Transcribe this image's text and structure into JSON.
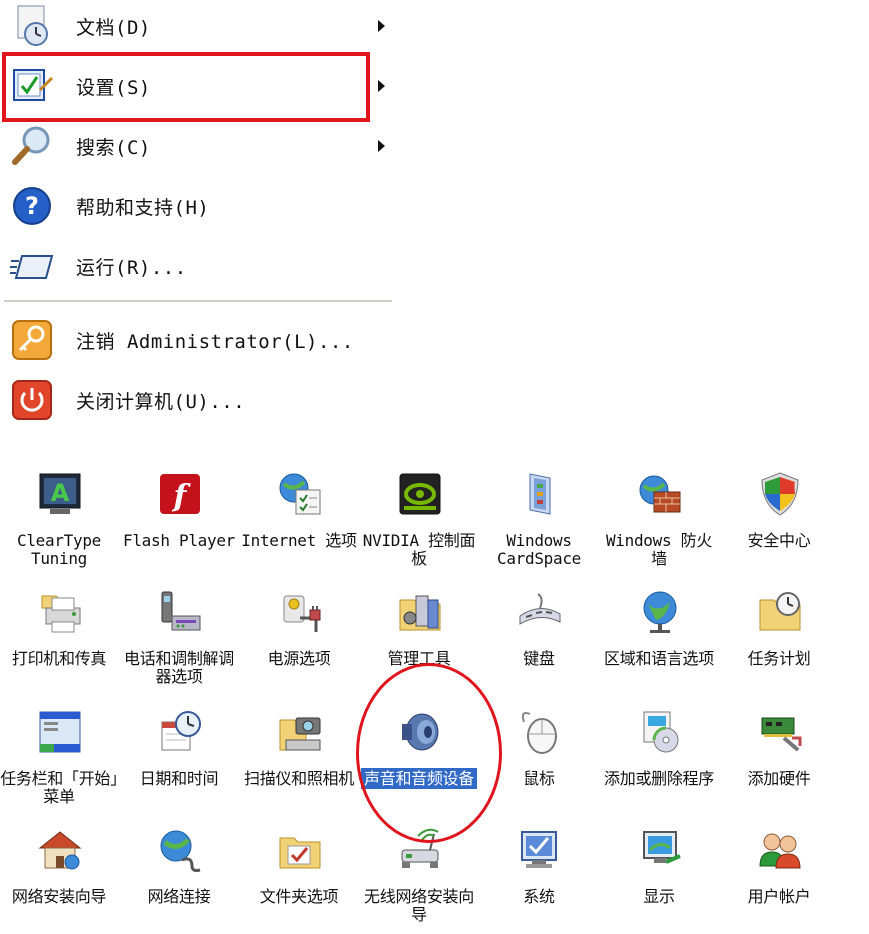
{
  "start_menu": {
    "items": [
      {
        "label": "文档(D)",
        "icon": "documents-icon",
        "has_submenu": true
      },
      {
        "label": "设置(S)",
        "icon": "settings-icon",
        "has_submenu": true
      },
      {
        "label": "搜索(C)",
        "icon": "search-icon",
        "has_submenu": true
      },
      {
        "label": "帮助和支持(H)",
        "icon": "help-icon",
        "has_submenu": false
      },
      {
        "label": "运行(R)...",
        "icon": "run-icon",
        "has_submenu": false
      },
      {
        "label": "注销 Administrator(L)...",
        "icon": "logoff-icon",
        "has_submenu": false
      },
      {
        "label": "关闭计算机(U)...",
        "icon": "shutdown-icon",
        "has_submenu": false
      }
    ],
    "highlight_color": "#e0141c"
  },
  "control_panel": {
    "selection_color": "#3169c6",
    "rows": [
      [
        {
          "label": "ClearType Tuning",
          "icon": "cleartype-icon"
        },
        {
          "label": "Flash Player",
          "icon": "flash-icon"
        },
        {
          "label": "Internet 选项",
          "icon": "internet-options-icon"
        },
        {
          "label": "NVIDIA 控制面板",
          "icon": "nvidia-icon"
        },
        {
          "label": "Windows CardSpace",
          "icon": "cardspace-icon"
        },
        {
          "label": "Windows 防火墙",
          "icon": "firewall-icon"
        },
        {
          "label": "安全中心",
          "icon": "security-center-icon"
        }
      ],
      [
        {
          "label": "打印机和传真",
          "icon": "printer-icon"
        },
        {
          "label": "电话和调制解调器选项",
          "icon": "phone-modem-icon"
        },
        {
          "label": "电源选项",
          "icon": "power-icon"
        },
        {
          "label": "管理工具",
          "icon": "admin-tools-icon"
        },
        {
          "label": "键盘",
          "icon": "keyboard-icon"
        },
        {
          "label": "区域和语言选项",
          "icon": "region-icon"
        },
        {
          "label": "任务计划",
          "icon": "scheduled-tasks-icon"
        }
      ],
      [
        {
          "label": "任务栏和「开始」菜单",
          "icon": "taskbar-icon"
        },
        {
          "label": "日期和时间",
          "icon": "datetime-icon"
        },
        {
          "label": "扫描仪和照相机",
          "icon": "scanner-icon"
        },
        {
          "label": "声音和音频设备",
          "icon": "sound-icon",
          "selected": true
        },
        {
          "label": "鼠标",
          "icon": "mouse-icon"
        },
        {
          "label": "添加或删除程序",
          "icon": "add-remove-icon"
        },
        {
          "label": "添加硬件",
          "icon": "add-hardware-icon"
        }
      ],
      [
        {
          "label": "网络安装向导",
          "icon": "network-wizard-icon"
        },
        {
          "label": "网络连接",
          "icon": "network-connections-icon"
        },
        {
          "label": "文件夹选项",
          "icon": "folder-options-icon"
        },
        {
          "label": "无线网络安装向导",
          "icon": "wireless-wizard-icon"
        },
        {
          "label": "系统",
          "icon": "system-icon"
        },
        {
          "label": "显示",
          "icon": "display-icon"
        },
        {
          "label": "用户帐户",
          "icon": "user-accounts-icon"
        }
      ]
    ]
  }
}
